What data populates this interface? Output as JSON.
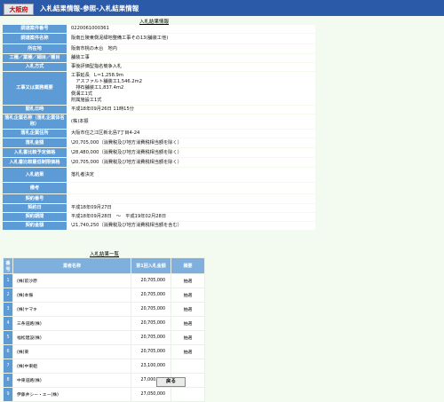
{
  "header": {
    "pref": "大阪府",
    "title": "入札結果情報-参照-入札結果情報"
  },
  "info": {
    "section_title": "入札結果情報",
    "rows": [
      {
        "label": "調達案件番号",
        "value": "0220061000361"
      },
      {
        "label": "調達案件名称",
        "value": "阪南丘陵東側泥緑地整備工事その13(舗装工他)"
      },
      {
        "label": "所在地",
        "value": "阪南市桃の木台　地内"
      },
      {
        "label": "工種／業種／細目／種目",
        "value": "舗装工事"
      },
      {
        "label": "入札方式",
        "value": "事後評価型指名競争入札"
      },
      {
        "label": "工事又は業務概要",
        "value": "工事延長　L＝1,258.9m\n　アスファルト舗装工1,546.2m2\n　排石舗装工1,837.4m2\n側溝工1式\n附属施設工1式"
      },
      {
        "label": "開札日時",
        "value": "平成18年09月26日 11時15分"
      },
      {
        "label": "落札企業名称（落札企業体名称）",
        "value": "(株)本振"
      },
      {
        "label": "落札企業住所",
        "value": "大阪市住之江区新北島7丁目4-24"
      },
      {
        "label": "落札金額",
        "value": "\\20,705,000（消費税及び地方消費税相当額を除く）"
      },
      {
        "label": "入札書比較予定価格",
        "value": "\\28,480,000（消費税及び地方消費税相当額を除く）"
      },
      {
        "label": "入札書比較最低制限価格",
        "value": "\\20,705,000（消費税及び地方消費税相当額を除く）"
      },
      {
        "label": "入札結果",
        "value": "落札者決定"
      },
      {
        "label": "備考",
        "value": ""
      },
      {
        "label": "契約番号",
        "value": ""
      },
      {
        "label": "契約日",
        "value": "平成18年09月27日"
      },
      {
        "label": "契約期間",
        "value": "平成18年09月28日　～　平成19年02月28日"
      },
      {
        "label": "契約金額",
        "value": "\\21,740,250（消費税及び地方消費税相当額を含む）"
      }
    ]
  },
  "results": {
    "section_title": "入札結果一覧",
    "headers": {
      "no": "番号",
      "name": "業者名称",
      "amount": "第1回入札金額",
      "summary": "摘要"
    },
    "rows": [
      {
        "no": "1",
        "name": "(株)前沙原",
        "amount": "20,705,000",
        "summary": "抽選"
      },
      {
        "no": "2",
        "name": "(株)本振",
        "amount": "20,705,000",
        "summary": "抽選"
      },
      {
        "no": "3",
        "name": "(株)ヤマキ",
        "amount": "20,705,000",
        "summary": "抽選"
      },
      {
        "no": "4",
        "name": "三条道路(株)",
        "amount": "20,705,000",
        "summary": "抽選"
      },
      {
        "no": "5",
        "name": "福松建設(株)",
        "amount": "20,705,000",
        "summary": "抽選"
      },
      {
        "no": "6",
        "name": "(株)東",
        "amount": "20,705,000",
        "summary": "抽選"
      },
      {
        "no": "7",
        "name": "(株)中東組",
        "amount": "23,100,000",
        "summary": ""
      },
      {
        "no": "8",
        "name": "中東道路(株)",
        "amount": "27,000,000",
        "summary": ""
      },
      {
        "no": "9",
        "name": "伊藤井シー・エー(株)",
        "amount": "27,050,000",
        "summary": ""
      }
    ]
  },
  "back_button": "戻る"
}
